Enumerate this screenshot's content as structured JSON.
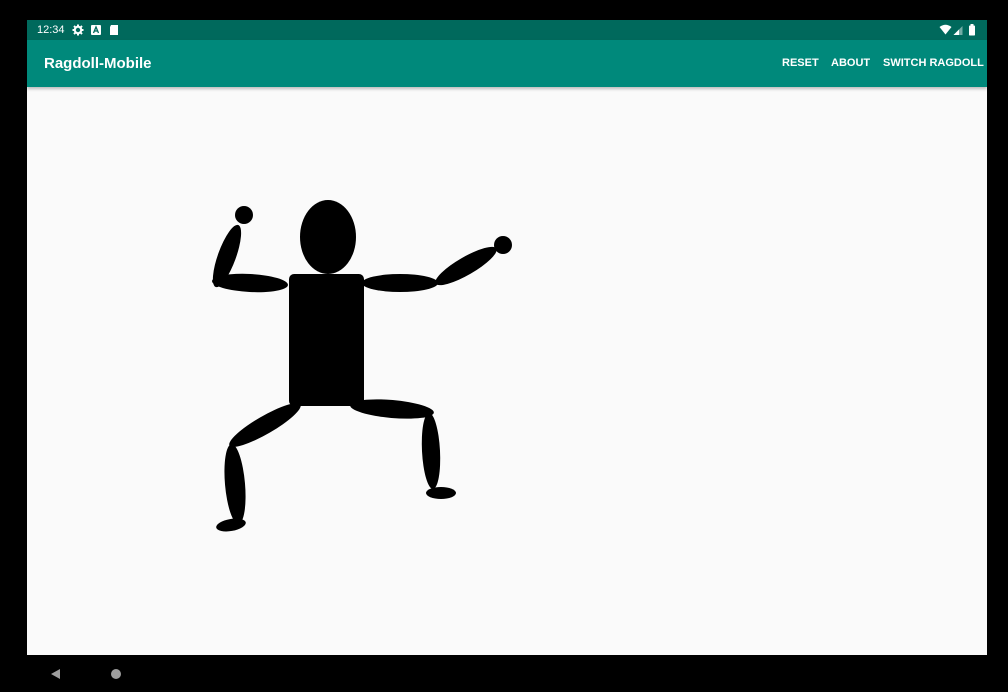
{
  "status_bar": {
    "time": "12:34",
    "icons_left": [
      "gear-icon",
      "notification-icon",
      "sd-card-icon"
    ],
    "icons_right": [
      "wifi-icon",
      "signal-icon",
      "battery-icon"
    ]
  },
  "app_bar": {
    "title": "Ragdoll-Mobile",
    "actions": [
      {
        "label": "RESET"
      },
      {
        "label": "ABOUT"
      },
      {
        "label": "SWITCH RAGDOLL"
      }
    ]
  },
  "ragdoll": {
    "parts": [
      "head",
      "torso",
      "left-upper-arm",
      "left-forearm",
      "left-hand",
      "right-upper-arm",
      "right-forearm",
      "right-hand",
      "left-thigh",
      "left-shin",
      "left-foot",
      "right-thigh",
      "right-shin",
      "right-foot"
    ]
  },
  "nav_bar": {
    "buttons": [
      "back-icon",
      "home-icon"
    ]
  },
  "colors": {
    "status_bar": "#00695c",
    "app_bar": "#00897b",
    "canvas_bg": "#fafafa",
    "ragdoll": "#000000"
  }
}
